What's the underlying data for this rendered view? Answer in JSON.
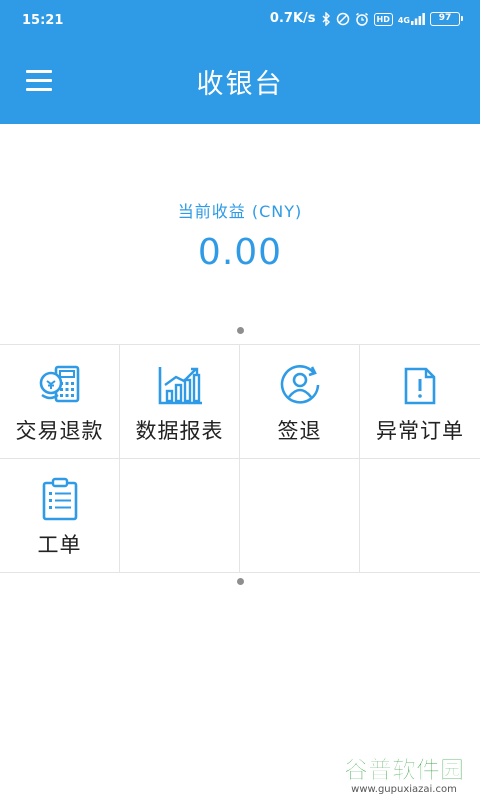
{
  "status_bar": {
    "time": "15:21",
    "net_speed": "0.7K/s",
    "badge": "HD",
    "signal": "4G",
    "battery": "97"
  },
  "app_bar": {
    "title": "收银台"
  },
  "summary": {
    "label": "当前收益 (CNY)",
    "amount": "0.00"
  },
  "menu_items": [
    {
      "label": "交易退款",
      "icon": "refund-calculator-icon"
    },
    {
      "label": "数据报表",
      "icon": "bar-chart-icon"
    },
    {
      "label": "签退",
      "icon": "user-signout-icon"
    },
    {
      "label": "异常订单",
      "icon": "exception-document-icon"
    },
    {
      "label": "工单",
      "icon": "clipboard-list-icon"
    }
  ],
  "watermark": {
    "brand": "谷普软件园",
    "url": "www.gupuxiazai.com"
  },
  "colors": {
    "primary": "#2f9be6",
    "text": "#222222",
    "divider": "#e4e4e4",
    "watermark_green": "#2e9a3a"
  }
}
